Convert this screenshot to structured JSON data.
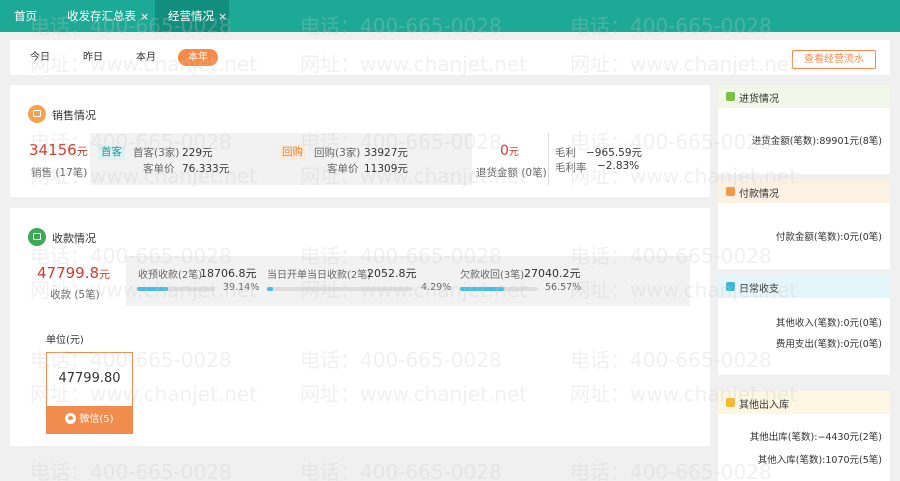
{
  "tabs": [
    {
      "label": "首页",
      "closable": false,
      "active": false
    },
    {
      "label": "收发存汇总表",
      "closable": true,
      "active": false
    },
    {
      "label": "经营情况",
      "closable": true,
      "active": true
    }
  ],
  "tab_close_glyph": "×",
  "watermark": {
    "phone": "电话：400-665-0028",
    "site": "网址：www.chanjet.net"
  },
  "period": {
    "buttons": [
      "今日",
      "昨日",
      "本月",
      "本年"
    ],
    "selected": "本年",
    "flow_button": "查看经营流水"
  },
  "sales": {
    "title": "销售情况",
    "amount": "34156",
    "unit": "元",
    "count_label": "销售 (17笔)",
    "first_tag": "首客",
    "first_label": "首客(3家)",
    "first_value": "229元",
    "first_avg_label": "客单价",
    "first_avg_value": "76.333元",
    "repeat_tag": "回购",
    "repeat_label": "回购(3家)",
    "repeat_value": "33927元",
    "repeat_avg_label": "客单价",
    "repeat_avg_value": "11309元",
    "return_amount": "0",
    "return_unit": "元",
    "return_label": "退货金额 (0笔)",
    "profit_label": "毛利",
    "profit_value": "−965.59元",
    "margin_label": "毛利率",
    "margin_value": "−2.83%"
  },
  "receipt": {
    "title": "收款情况",
    "amount": "47799.8",
    "unit": "元",
    "count_label": "收款 (5笔)",
    "items": [
      {
        "label": "收预收款(2笔)",
        "value": "18706.8元",
        "percent_text": "39.14%",
        "percent": 39.14
      },
      {
        "label": "当日开单当日收款(2笔)",
        "value": "2052.8元",
        "percent_text": "4.29%",
        "percent": 4.29
      },
      {
        "label": "欠款收回(3笔)",
        "value": "27040.2元",
        "percent_text": "56.57%",
        "percent": 56.57
      }
    ],
    "unit_label": "单位(元)",
    "method_value": "47799.80",
    "method_label": "微信(5)"
  },
  "side": {
    "purchase": {
      "title": "进货情况",
      "lines": [
        "进货金额(笔数):89901元(8笔)"
      ],
      "color": "#7bbf44",
      "bg": "#f1f8e9"
    },
    "payment": {
      "title": "付款情况",
      "lines": [
        "付款金额(笔数):0元(0笔)"
      ],
      "color": "#f29a4a",
      "bg": "#fdf1e4"
    },
    "daily": {
      "title": "日常收支",
      "lines": [
        "其他收入(笔数):0元(0笔)",
        "费用支出(笔数):0元(0笔)"
      ],
      "color": "#3cb8d6",
      "bg": "#e5f6fa"
    },
    "stock": {
      "title": "其他出入库",
      "lines": [
        "其他出库(笔数):−4430元(2笔)",
        "其他入库(笔数):1070元(5笔)"
      ],
      "color": "#f5b82e",
      "bg": "#fdf6e3"
    }
  },
  "colors": {
    "topbar": "#1ca995",
    "accent": "#f28c4e",
    "amount_red": "#d33a2f",
    "progress": "#42bfe4",
    "sales_icon": "#f5a14d",
    "receipt_icon": "#3aaa55"
  },
  "icons": {
    "sales": "cart-icon",
    "receipt": "money-icon"
  }
}
